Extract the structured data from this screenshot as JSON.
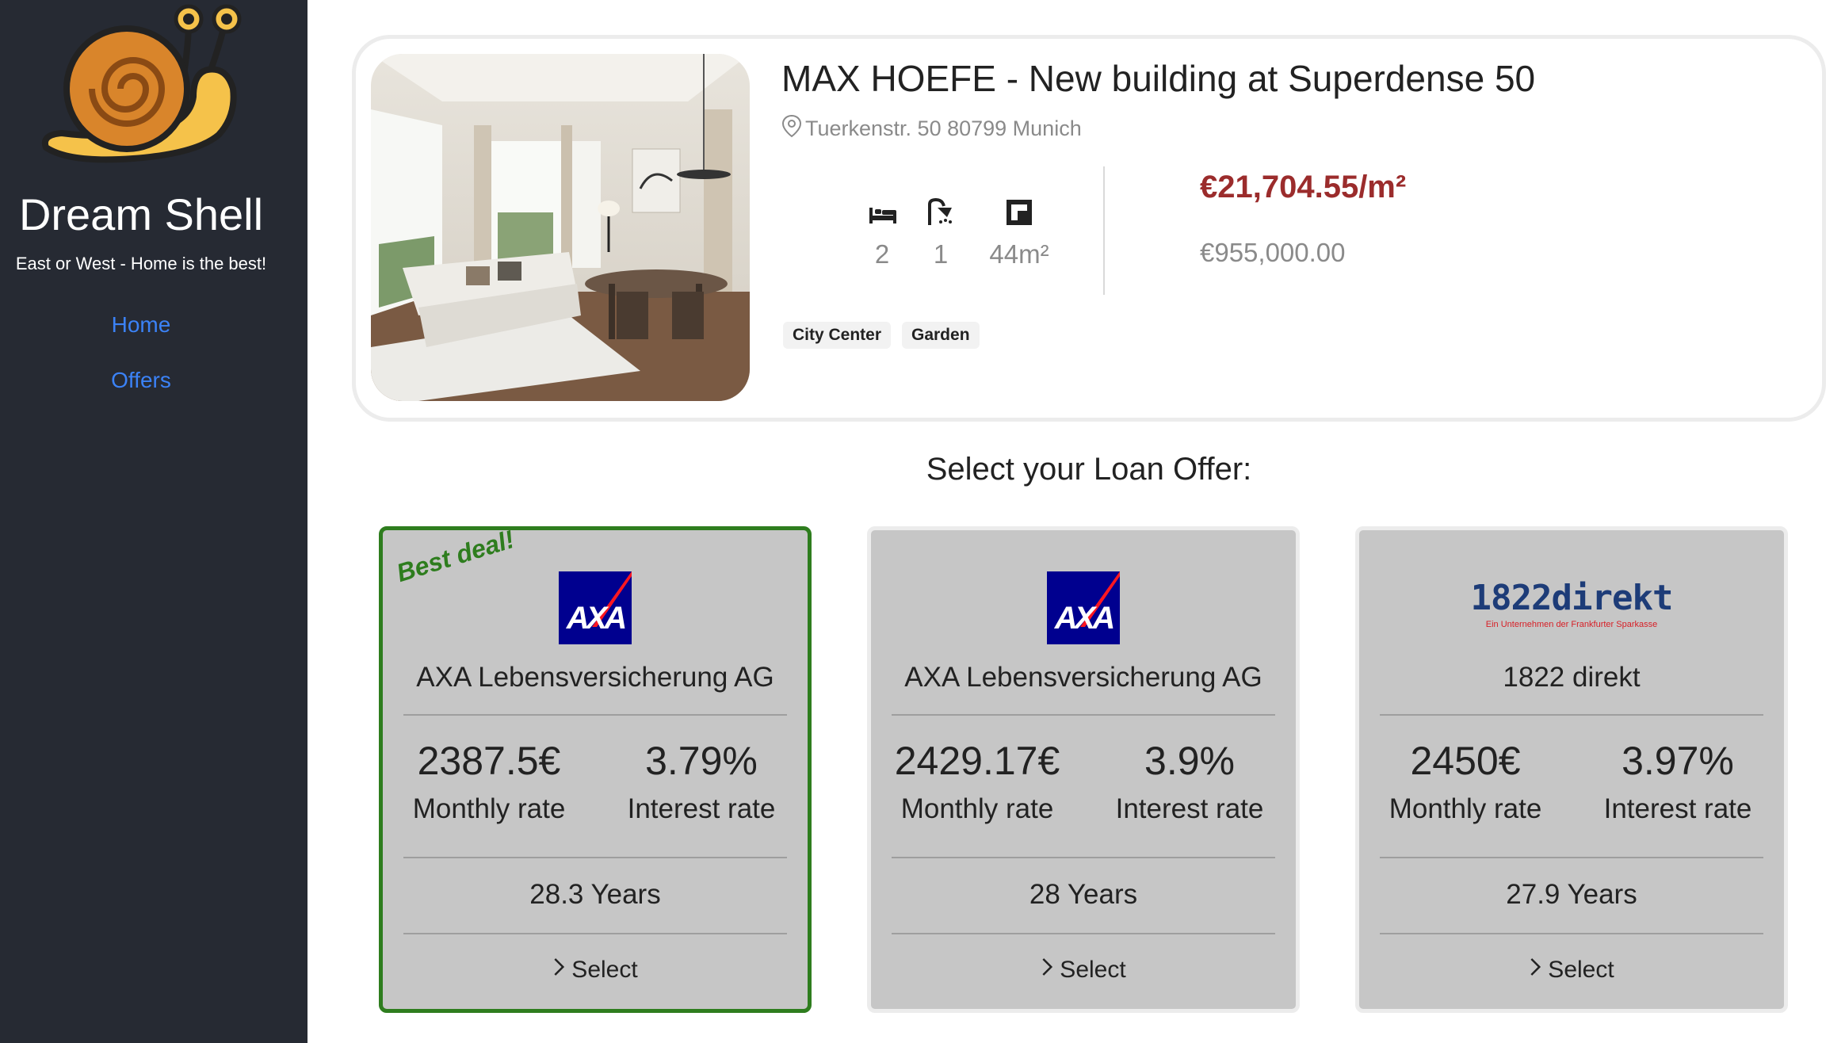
{
  "sidebar": {
    "brand": "Dream Shell",
    "tagline": "East or West - Home is the best!",
    "nav": [
      {
        "label": "Home"
      },
      {
        "label": "Offers"
      }
    ]
  },
  "property": {
    "title": "MAX HOEFE - New building at Superdense 50",
    "address": "Tuerkenstr. 50 80799 Munich",
    "features": {
      "beds": "2",
      "baths": "1",
      "area": "44m²"
    },
    "price_per_m2": "€21,704.55/m²",
    "price_total": "€955,000.00",
    "tags": [
      "City Center",
      "Garden"
    ]
  },
  "section_title": "Select your Loan Offer:",
  "offers": [
    {
      "badge": "Best deal!",
      "logo": "AXA",
      "bank": "AXA Lebensversicherung AG",
      "monthly_rate": "2387.5€",
      "monthly_label": "Monthly rate",
      "interest_rate": "3.79%",
      "interest_label": "Interest rate",
      "duration": "28.3 Years",
      "select_label": "Select"
    },
    {
      "logo": "AXA",
      "bank": "AXA Lebensversicherung AG",
      "monthly_rate": "2429.17€",
      "monthly_label": "Monthly rate",
      "interest_rate": "3.9%",
      "interest_label": "Interest rate",
      "duration": "28 Years",
      "select_label": "Select"
    },
    {
      "logo": "1822direkt",
      "logo_subtitle": "Ein Unternehmen der Frankfurter Sparkasse",
      "bank": "1822 direkt",
      "monthly_rate": "2450€",
      "monthly_label": "Monthly rate",
      "interest_rate": "3.97%",
      "interest_label": "Interest rate",
      "duration": "27.9 Years",
      "select_label": "Select"
    }
  ],
  "colors": {
    "sidebar_bg": "#262a33",
    "nav_link": "#3b82f6",
    "price_accent": "#9b2c2c",
    "best_deal": "#2e7d1e",
    "offer_bg": "#c6c6c6",
    "axa_blue": "#00008f",
    "axa_red": "#ff1721"
  },
  "icons": [
    "snail-logo",
    "location-pin-icon",
    "bed-icon",
    "shower-icon",
    "floor-area-icon",
    "chevron-right-icon"
  ]
}
